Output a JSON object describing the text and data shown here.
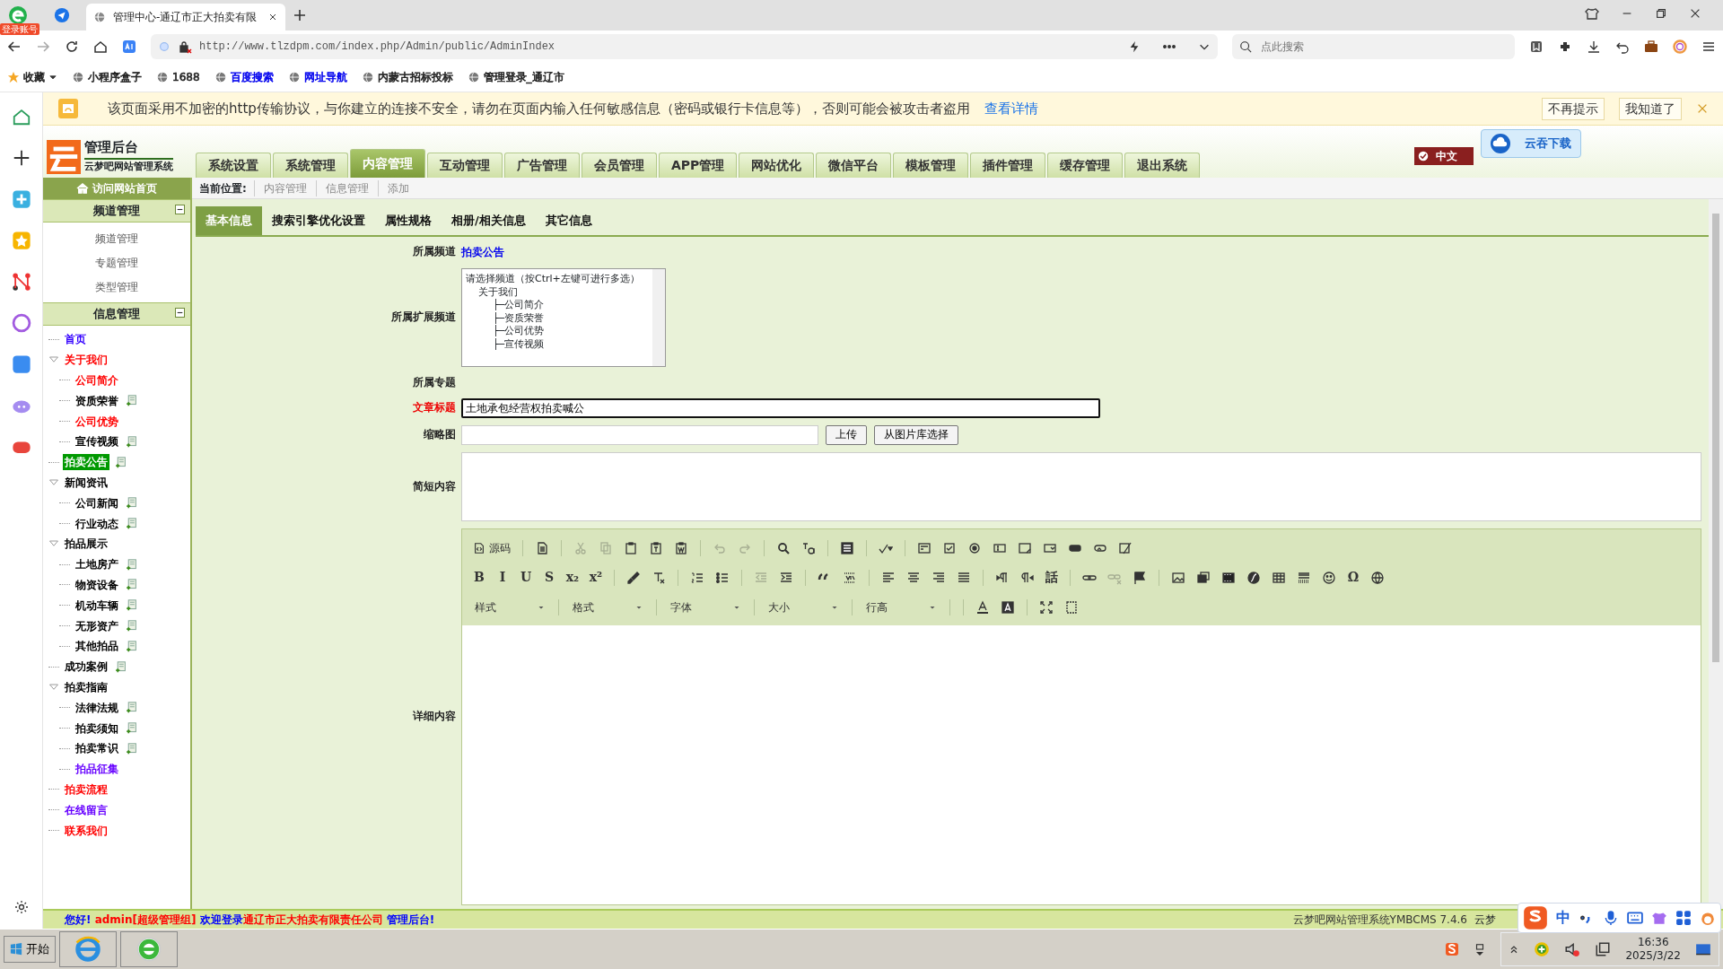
{
  "browser": {
    "login_badge": "登录账号",
    "tabs": [
      {
        "title": "管理中心-通辽市正大拍卖有限",
        "selected": true
      }
    ],
    "url": "http://www.tlzdpm.com/index.php/Admin/public/AdminIndex",
    "search": {
      "placeholder": "点此搜索"
    },
    "bookmarks": [
      {
        "label": "收藏",
        "kind": "favorites",
        "color": "#222222"
      },
      {
        "label": "小程序盒子",
        "kind": "site",
        "color": "#222222"
      },
      {
        "label": "1688",
        "kind": "site",
        "color": "#222222"
      },
      {
        "label": "百度搜索",
        "kind": "site",
        "color": "#0000ee"
      },
      {
        "label": "网址导航",
        "kind": "site",
        "color": "#0000ee"
      },
      {
        "label": "内蒙古招标投标",
        "kind": "site",
        "color": "#222222"
      },
      {
        "label": "管理登录_通辽市",
        "kind": "site",
        "color": "#222222"
      }
    ]
  },
  "warning": {
    "text": "该页面采用不加密的http传输协议，与你建立的连接不安全，请勿在页面内输入任何敏感信息（密码或银行卡信息等），否则可能会被攻击者盗用",
    "link": "查看详情",
    "buttons": [
      "不再提示",
      "我知道了"
    ]
  },
  "header": {
    "title": "管理后台",
    "subtitle": "云梦吧网站管理系统",
    "nav": [
      {
        "label": "系统设置",
        "selected": false
      },
      {
        "label": "系统管理",
        "selected": false
      },
      {
        "label": "内容管理",
        "selected": true
      },
      {
        "label": "互动管理",
        "selected": false
      },
      {
        "label": "广告管理",
        "selected": false
      },
      {
        "label": "会员管理",
        "selected": false
      },
      {
        "label": "APP管理",
        "selected": false
      },
      {
        "label": "网站优化",
        "selected": false
      },
      {
        "label": "微信平台",
        "selected": false
      },
      {
        "label": "模板管理",
        "selected": false
      },
      {
        "label": "插件管理",
        "selected": false
      },
      {
        "label": "缓存管理",
        "selected": false
      },
      {
        "label": "退出系统",
        "selected": false
      }
    ],
    "language": "中文",
    "download_badge": "云吞下载"
  },
  "sidebar": {
    "home_link": "访问网站首页",
    "sections": [
      {
        "title": "频道管理",
        "expanded": true,
        "links": [
          "频道管理",
          "专题管理",
          "类型管理"
        ]
      },
      {
        "title": "信息管理",
        "expanded": true,
        "tree": [
          {
            "label": "首页",
            "color": "#3300ff",
            "selected": false,
            "addable": false
          },
          {
            "label": "关于我们",
            "color": "#ff0000",
            "selected": false,
            "addable": false,
            "expanded": true,
            "children": [
              {
                "label": "公司简介",
                "color": "#ff0000",
                "selected": false,
                "addable": false
              },
              {
                "label": "资质荣誉",
                "color": "#000000",
                "selected": false,
                "addable": true
              },
              {
                "label": "公司优势",
                "color": "#ff0000",
                "selected": false,
                "addable": false
              },
              {
                "label": "宣传视频",
                "color": "#000000",
                "selected": false,
                "addable": true
              }
            ]
          },
          {
            "label": "拍卖公告",
            "color": "#009900",
            "selected": true,
            "addable": true
          },
          {
            "label": "新闻资讯",
            "color": "#000000",
            "selected": false,
            "addable": false,
            "expanded": true,
            "children": [
              {
                "label": "公司新闻",
                "color": "#000000",
                "selected": false,
                "addable": true
              },
              {
                "label": "行业动态",
                "color": "#000000",
                "selected": false,
                "addable": true
              }
            ]
          },
          {
            "label": "拍品展示",
            "color": "#000000",
            "selected": false,
            "addable": false,
            "expanded": true,
            "children": [
              {
                "label": "土地房产",
                "color": "#000000",
                "selected": false,
                "addable": true
              },
              {
                "label": "物资设备",
                "color": "#000000",
                "selected": false,
                "addable": true
              },
              {
                "label": "机动车辆",
                "color": "#000000",
                "selected": false,
                "addable": true
              },
              {
                "label": "无形资产",
                "color": "#000000",
                "selected": false,
                "addable": true
              },
              {
                "label": "其他拍品",
                "color": "#000000",
                "selected": false,
                "addable": true
              }
            ]
          },
          {
            "label": "成功案例",
            "color": "#000000",
            "selected": false,
            "addable": true
          },
          {
            "label": "拍卖指南",
            "color": "#000000",
            "selected": false,
            "addable": false,
            "expanded": true,
            "children": [
              {
                "label": "法律法规",
                "color": "#000000",
                "selected": false,
                "addable": true
              },
              {
                "label": "拍卖须知",
                "color": "#000000",
                "selected": false,
                "addable": true
              },
              {
                "label": "拍卖常识",
                "color": "#000000",
                "selected": false,
                "addable": true
              },
              {
                "label": "拍品征集",
                "color": "#6600ff",
                "selected": false,
                "addable": false
              }
            ]
          },
          {
            "label": "拍卖流程",
            "color": "#ff0000",
            "selected": false,
            "addable": false
          },
          {
            "label": "在线留言",
            "color": "#6600ff",
            "selected": false,
            "addable": false
          },
          {
            "label": "联系我们",
            "color": "#ff0000",
            "selected": false,
            "addable": false
          }
        ]
      }
    ]
  },
  "breadcrumb": {
    "label": "当前位置:",
    "items": [
      "内容管理",
      "信息管理",
      "添加"
    ]
  },
  "form": {
    "tabs": [
      {
        "label": "基本信息",
        "selected": true
      },
      {
        "label": "搜索引擎优化设置",
        "selected": false
      },
      {
        "label": "属性规格",
        "selected": false
      },
      {
        "label": "相册/相关信息",
        "selected": false
      },
      {
        "label": "其它信息",
        "selected": false
      }
    ],
    "fields": [
      {
        "kind": "link",
        "label": "所属频道",
        "required": false,
        "value": "拍卖公告"
      },
      {
        "kind": "listbox",
        "label": "所属扩展频道",
        "required": false,
        "options": [
          {
            "label": "请选择频道（按Ctrl+左键可进行多选）"
          },
          {
            "label": "关于我们",
            "children": [
              {
                "label": "├─公司简介"
              },
              {
                "label": "├─资质荣誉"
              },
              {
                "label": "├─公司优势"
              },
              {
                "label": "├─宣传视频"
              }
            ]
          }
        ]
      },
      {
        "kind": "empty",
        "label": "所属专题",
        "required": false
      },
      {
        "kind": "text",
        "label": "文章标题",
        "required": true,
        "focused": true,
        "value": "土地承包经营权拍卖喊公"
      },
      {
        "kind": "upload",
        "label": "缩略图",
        "required": false,
        "buttons": [
          "上传",
          "从图片库选择"
        ]
      },
      {
        "kind": "textarea",
        "label": "简短内容",
        "required": false
      },
      {
        "kind": "editor",
        "label": "详细内容",
        "required": false,
        "toolbar": [
          [
            {
              "kind": "button",
              "label": "源码"
            },
            {
              "kind": "sep"
            },
            {
              "kind": "icon",
              "disabled": false
            },
            {
              "kind": "sep"
            },
            {
              "kind": "icon",
              "disabled": true
            },
            {
              "kind": "icon",
              "disabled": true
            },
            {
              "kind": "icon",
              "disabled": false
            },
            {
              "kind": "icon",
              "disabled": false
            },
            {
              "kind": "icon",
              "disabled": false
            },
            {
              "kind": "sep"
            },
            {
              "kind": "icon",
              "disabled": true
            },
            {
              "kind": "icon",
              "disabled": true
            },
            {
              "kind": "sep"
            },
            {
              "kind": "icon",
              "disabled": false
            },
            {
              "kind": "icon",
              "disabled": false
            },
            {
              "kind": "sep"
            },
            {
              "kind": "icon",
              "disabled": false
            },
            {
              "kind": "sep"
            },
            {
              "kind": "icon",
              "disabled": false
            },
            {
              "kind": "sep"
            },
            {
              "kind": "icon",
              "disabled": false
            },
            {
              "kind": "icon",
              "disabled": false
            },
            {
              "kind": "icon",
              "disabled": false
            },
            {
              "kind": "icon",
              "disabled": false
            },
            {
              "kind": "icon",
              "disabled": false
            },
            {
              "kind": "icon",
              "disabled": false
            },
            {
              "kind": "icon",
              "disabled": false
            },
            {
              "kind": "icon",
              "disabled": false
            },
            {
              "kind": "icon",
              "disabled": false
            }
          ],
          [
            {
              "kind": "glyph",
              "text": "B"
            },
            {
              "kind": "glyph",
              "text": "I"
            },
            {
              "kind": "glyph",
              "text": "U"
            },
            {
              "kind": "glyph",
              "text": "S"
            },
            {
              "kind": "glyph",
              "text": "x₂"
            },
            {
              "kind": "glyph",
              "text": "x²"
            },
            {
              "kind": "sep"
            },
            {
              "kind": "icon",
              "disabled": false
            },
            {
              "kind": "icon",
              "disabled": false
            },
            {
              "kind": "sep"
            },
            {
              "kind": "icon",
              "disabled": false
            },
            {
              "kind": "icon",
              "disabled": false
            },
            {
              "kind": "sep"
            },
            {
              "kind": "icon",
              "disabled": true
            },
            {
              "kind": "icon",
              "disabled": false
            },
            {
              "kind": "sep"
            },
            {
              "kind": "icon",
              "disabled": false
            },
            {
              "kind": "icon",
              "disabled": false
            },
            {
              "kind": "sep"
            },
            {
              "kind": "icon",
              "disabled": false
            },
            {
              "kind": "icon",
              "disabled": false
            },
            {
              "kind": "icon",
              "disabled": false
            },
            {
              "kind": "icon",
              "disabled": false
            },
            {
              "kind": "sep"
            },
            {
              "kind": "icon",
              "disabled": false
            },
            {
              "kind": "icon",
              "disabled": false
            },
            {
              "kind": "glyph",
              "text": "話"
            },
            {
              "kind": "sep"
            },
            {
              "kind": "icon",
              "disabled": false
            },
            {
              "kind": "icon",
              "disabled": true
            },
            {
              "kind": "icon",
              "disabled": false
            },
            {
              "kind": "sep"
            },
            {
              "kind": "icon",
              "disabled": false
            },
            {
              "kind": "icon",
              "disabled": false
            },
            {
              "kind": "icon",
              "disabled": false
            },
            {
              "kind": "icon",
              "disabled": false
            },
            {
              "kind": "icon",
              "disabled": false
            },
            {
              "kind": "icon",
              "disabled": false
            },
            {
              "kind": "icon",
              "disabled": false
            },
            {
              "kind": "glyph",
              "text": "Ω"
            },
            {
              "kind": "icon",
              "disabled": false
            }
          ],
          [
            {
              "kind": "dropdown",
              "label": "样式"
            },
            {
              "kind": "dropdown",
              "label": "格式"
            },
            {
              "kind": "dropdown",
              "label": "字体"
            },
            {
              "kind": "dropdown",
              "label": "大小"
            },
            {
              "kind": "dropdown",
              "label": "行高"
            },
            {
              "kind": "sep"
            },
            {
              "kind": "icon",
              "disabled": false
            },
            {
              "kind": "icon",
              "disabled": false
            },
            {
              "kind": "sep"
            },
            {
              "kind": "icon",
              "disabled": false
            },
            {
              "kind": "icon",
              "disabled": false
            }
          ]
        ]
      }
    ]
  },
  "status_bar": {
    "welcome": [
      {
        "text": "您好!",
        "color": "#0000ff"
      },
      {
        "text": " admin[超级管理组] ",
        "color": "#ff0000"
      },
      {
        "text": "欢迎登录",
        "color": "#0000ff"
      },
      {
        "text": "通辽市正大拍卖有限责任公司",
        "color": "#ff0000"
      },
      {
        "text": " 管理后台!",
        "color": "#0000ff"
      }
    ],
    "version": "云梦吧网站管理系统YMBCMS 7.4.6",
    "version_tail": "云梦"
  },
  "ime_bar": {
    "mode": "中"
  },
  "taskbar": {
    "start": "开始",
    "time": "16:36",
    "date": "2025/3/22"
  }
}
